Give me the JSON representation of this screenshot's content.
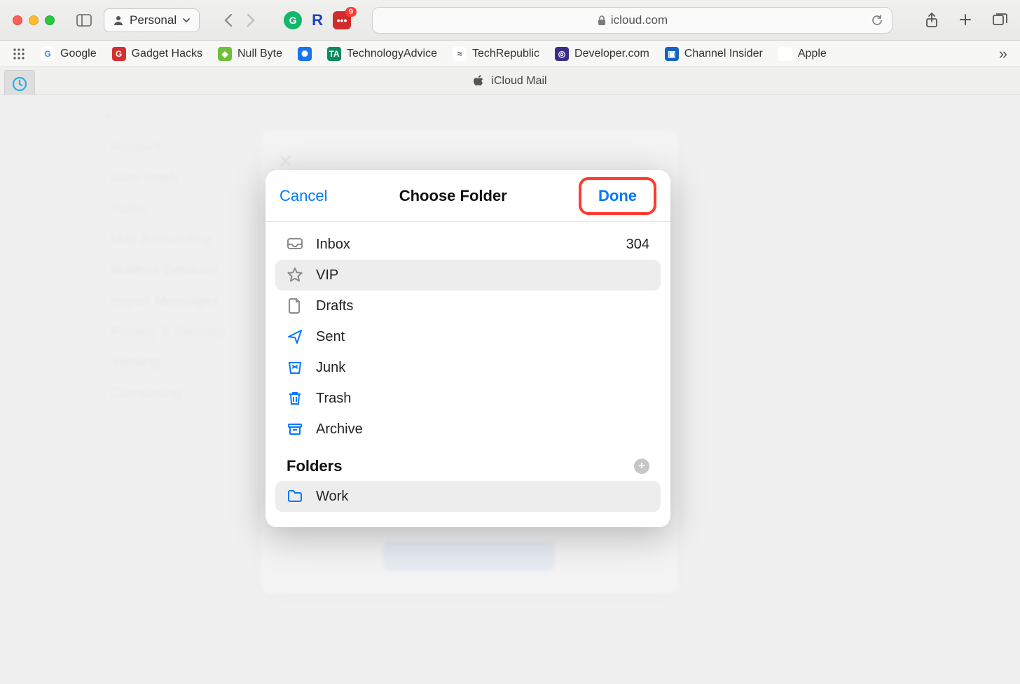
{
  "browser": {
    "profile_label": "Personal",
    "address_domain": "icloud.com",
    "ext_badge_count": "9"
  },
  "bookmarks": [
    {
      "label": "Google",
      "bg": "#ffffff",
      "fg": "#4285F4",
      "letter": "G"
    },
    {
      "label": "Gadget Hacks",
      "bg": "#d32f2f",
      "fg": "#ffffff",
      "letter": "G"
    },
    {
      "label": "Null Byte",
      "bg": "#6fbf3c",
      "fg": "#ffffff",
      "letter": "◈"
    },
    {
      "label": "",
      "bg": "#1a73e8",
      "fg": "#ffffff",
      "letter": "✺"
    },
    {
      "label": "TechnologyAdvice",
      "bg": "#0b8a5b",
      "fg": "#ffffff",
      "letter": "TA"
    },
    {
      "label": "TechRepublic",
      "bg": "#ffffff",
      "fg": "#333333",
      "letter": "≈"
    },
    {
      "label": "Developer.com",
      "bg": "#3b2e86",
      "fg": "#ffffff",
      "letter": "◎"
    },
    {
      "label": "Channel Insider",
      "bg": "#1565c0",
      "fg": "#ffffff",
      "letter": "▣"
    },
    {
      "label": "Apple",
      "bg": "#ffffff",
      "fg": "#000000",
      "letter": ""
    }
  ],
  "tab": {
    "title": "iCloud Mail"
  },
  "dim_items": [
    "Account",
    "Auto-Reply",
    "Rules",
    "Mail Forwarding",
    "Mailbox Behavior",
    "Import Messages",
    "Privacy & Security",
    "Viewing",
    "Composing"
  ],
  "modal": {
    "cancel": "Cancel",
    "title": "Choose Folder",
    "done": "Done",
    "system_folders": [
      {
        "name": "Inbox",
        "icon": "inbox",
        "color": "gray",
        "count": "304",
        "selected": false
      },
      {
        "name": "VIP",
        "icon": "star",
        "color": "gray",
        "count": "",
        "selected": true
      },
      {
        "name": "Drafts",
        "icon": "doc",
        "color": "gray",
        "count": "",
        "selected": false
      },
      {
        "name": "Sent",
        "icon": "send",
        "color": "blue",
        "count": "",
        "selected": false
      },
      {
        "name": "Junk",
        "icon": "junk",
        "color": "blue",
        "count": "",
        "selected": false
      },
      {
        "name": "Trash",
        "icon": "trash",
        "color": "blue",
        "count": "",
        "selected": false
      },
      {
        "name": "Archive",
        "icon": "archive",
        "color": "blue",
        "count": "",
        "selected": false
      }
    ],
    "folders_header": "Folders",
    "user_folders": [
      {
        "name": "Work",
        "selected": true
      }
    ]
  }
}
